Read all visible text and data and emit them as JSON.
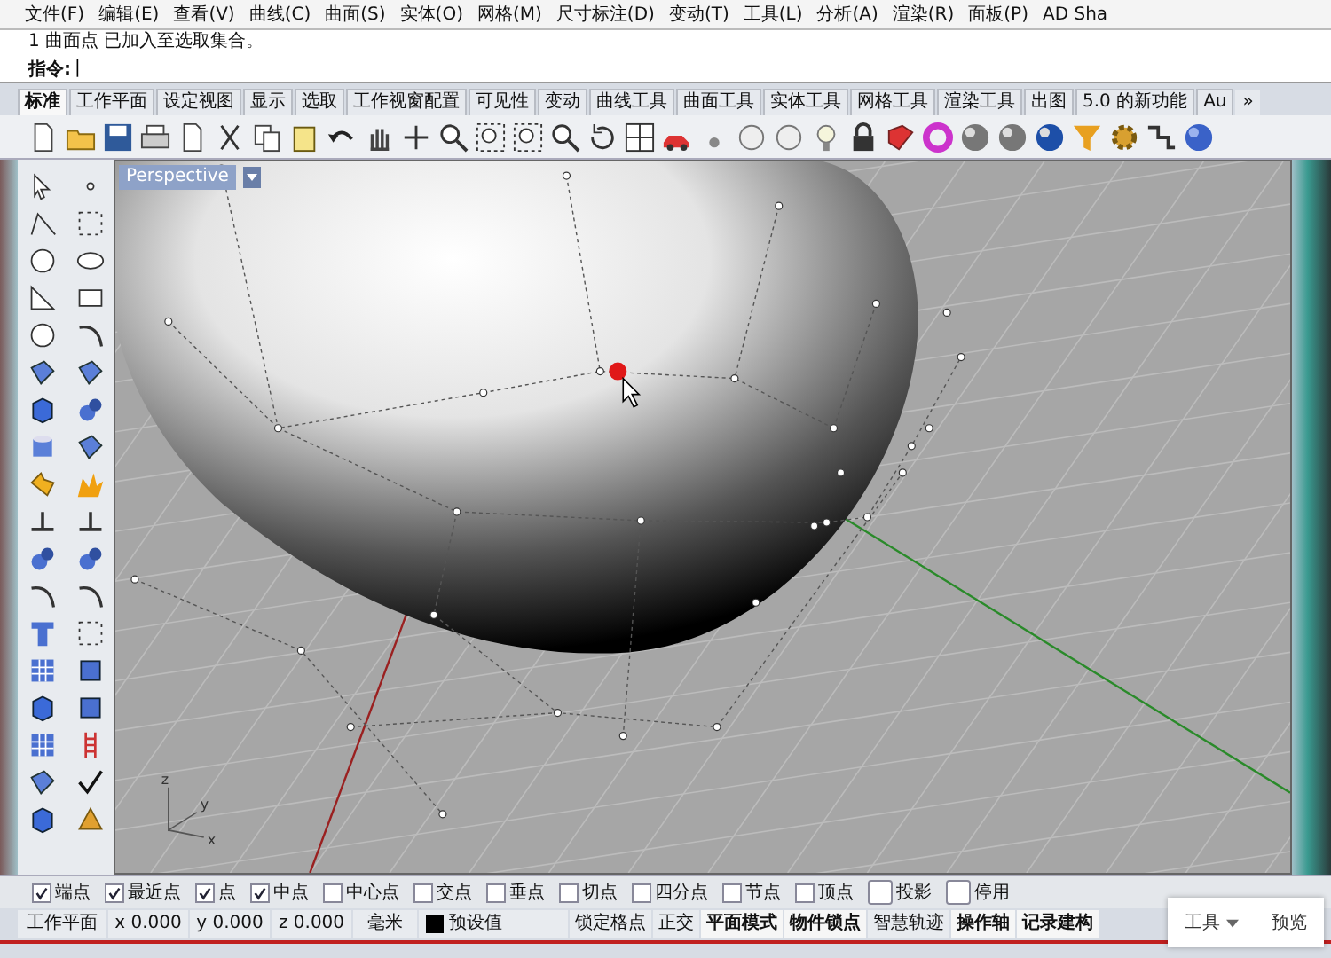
{
  "menu": [
    "文件(F)",
    "编辑(E)",
    "查看(V)",
    "曲线(C)",
    "曲面(S)",
    "实体(O)",
    "网格(M)",
    "尺寸标注(D)",
    "变动(T)",
    "工具(L)",
    "分析(A)",
    "渲染(R)",
    "面板(P)",
    "AD Sha"
  ],
  "history": "1 曲面点 已加入至选取集合。",
  "command": {
    "label": "指令:",
    "value": "|"
  },
  "tabs": [
    {
      "label": "标准",
      "selected": true
    },
    {
      "label": "工作平面",
      "selected": false
    },
    {
      "label": "设定视图",
      "selected": false
    },
    {
      "label": "显示",
      "selected": false
    },
    {
      "label": "选取",
      "selected": false
    },
    {
      "label": "工作视窗配置",
      "selected": false
    },
    {
      "label": "可见性",
      "selected": false
    },
    {
      "label": "变动",
      "selected": false
    },
    {
      "label": "曲线工具",
      "selected": false
    },
    {
      "label": "曲面工具",
      "selected": false
    },
    {
      "label": "实体工具",
      "selected": false
    },
    {
      "label": "网格工具",
      "selected": false
    },
    {
      "label": "渲染工具",
      "selected": false
    },
    {
      "label": "出图",
      "selected": false
    },
    {
      "label": "5.0 的新功能",
      "selected": false
    },
    {
      "label": "Au",
      "selected": false
    }
  ],
  "tab_overflow": "»",
  "viewport": {
    "title": "Perspective",
    "axis_labels": [
      "z",
      "y",
      "x"
    ]
  },
  "osnaps": [
    {
      "label": "端点",
      "checked": true,
      "kind": "osnap"
    },
    {
      "label": "最近点",
      "checked": true,
      "kind": "osnap"
    },
    {
      "label": "点",
      "checked": true,
      "kind": "osnap"
    },
    {
      "label": "中点",
      "checked": true,
      "kind": "osnap"
    },
    {
      "label": "中心点",
      "checked": false,
      "kind": "osnap"
    },
    {
      "label": "交点",
      "checked": false,
      "kind": "osnap"
    },
    {
      "label": "垂点",
      "checked": false,
      "kind": "osnap"
    },
    {
      "label": "切点",
      "checked": false,
      "kind": "osnap"
    },
    {
      "label": "四分点",
      "checked": false,
      "kind": "osnap"
    },
    {
      "label": "节点",
      "checked": false,
      "kind": "osnap"
    },
    {
      "label": "顶点",
      "checked": false,
      "kind": "osnap"
    },
    {
      "label": "投影",
      "checked": false,
      "kind": "toggle"
    },
    {
      "label": "停用",
      "checked": false,
      "kind": "toggle"
    }
  ],
  "status_bar": {
    "cplane": "工作平面",
    "coords": [
      "x 0.000",
      "y 0.000",
      "z 0.000"
    ],
    "units": "毫米",
    "layer": {
      "name": "预设值",
      "color": "#000000"
    },
    "panes": [
      {
        "label": "锁定格点",
        "on": false
      },
      {
        "label": "正交",
        "on": false
      },
      {
        "label": "平面模式",
        "on": true
      },
      {
        "label": "物件锁点",
        "on": true
      },
      {
        "label": "智慧轨迹",
        "on": false
      },
      {
        "label": "操作轴",
        "on": true
      },
      {
        "label": "记录建构",
        "on": true
      }
    ]
  },
  "popup": {
    "menu": "工具",
    "preview": "预览"
  }
}
